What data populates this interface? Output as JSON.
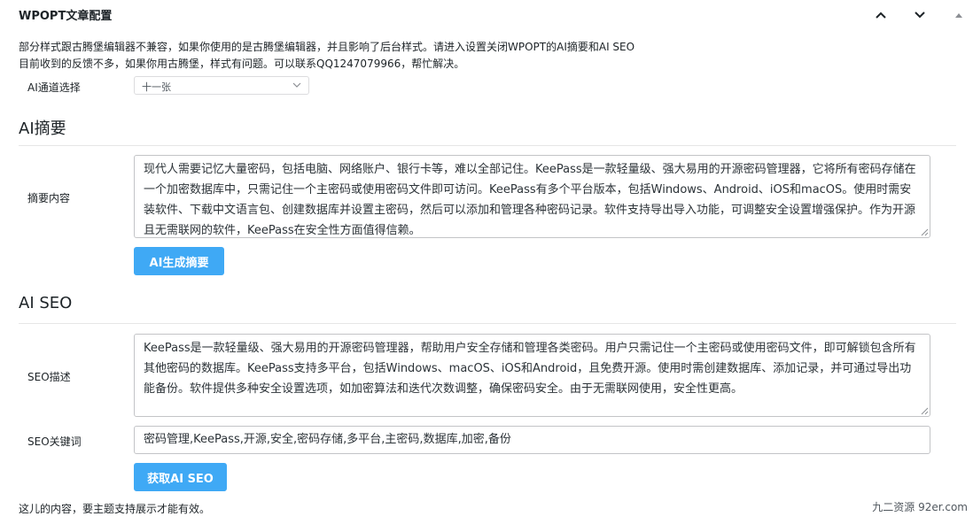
{
  "panel": {
    "title": "WPOPT文章配置",
    "notice_line1": "部分样式跟古腾堡编辑器不兼容，如果你使用的是古腾堡编辑器，并且影响了后台样式。请进入设置关闭WPOPT的AI摘要和AI SEO",
    "notice_line2": "目前收到的反馈不多，如果你用古腾堡，样式有问题。可以联系QQ1247079966，帮忙解决。"
  },
  "ai_channel": {
    "label": "AI通道选择",
    "selected": "十一张"
  },
  "summary_section": {
    "title": "AI摘要",
    "field_label": "摘要内容",
    "content": "现代人需要记忆大量密码，包括电脑、网络账户、银行卡等，难以全部记住。KeePass是一款轻量级、强大易用的开源密码管理器，它将所有密码存储在一个加密数据库中，只需记住一个主密码或使用密码文件即可访问。KeePass有多个平台版本，包括Windows、Android、iOS和macOS。使用时需安装软件、下载中文语言包、创建数据库并设置主密码，然后可以添加和管理各种密码记录。软件支持导出导入功能，可调整安全设置增强保护。作为开源且无需联网的软件，KeePass在安全性方面值得信赖。",
    "button_label": "AI生成摘要"
  },
  "seo_section": {
    "title": "AI SEO",
    "desc_label": "SEO描述",
    "desc_content": "KeePass是一款轻量级、强大易用的开源密码管理器，帮助用户安全存储和管理各类密码。用户只需记住一个主密码或使用密码文件，即可解锁包含所有其他密码的数据库。KeePass支持多平台，包括Windows、macOS、iOS和Android，且免费开源。使用时需创建数据库、添加记录，并可通过导出功能备份。软件提供多种安全设置选项，如加密算法和迭代次数调整，确保密码安全。由于无需联网使用，安全性更高。",
    "keywords_label": "SEO关键词",
    "keywords_value": "密码管理,KeePass,开源,安全,密码存储,多平台,主密码,数据库,加密,备份",
    "button_label": "获取AI SEO"
  },
  "footer": {
    "note": "这儿的内容，要主题支持展示才能有效。",
    "watermark": "九二资源 92er.com"
  },
  "icons": {
    "move_up": "chevron-up-icon",
    "move_down": "chevron-down-icon",
    "toggle": "triangle-up-icon"
  },
  "colors": {
    "button_bg": "#3fa9f5",
    "text": "#1d2327",
    "border": "#c3c4c7"
  }
}
